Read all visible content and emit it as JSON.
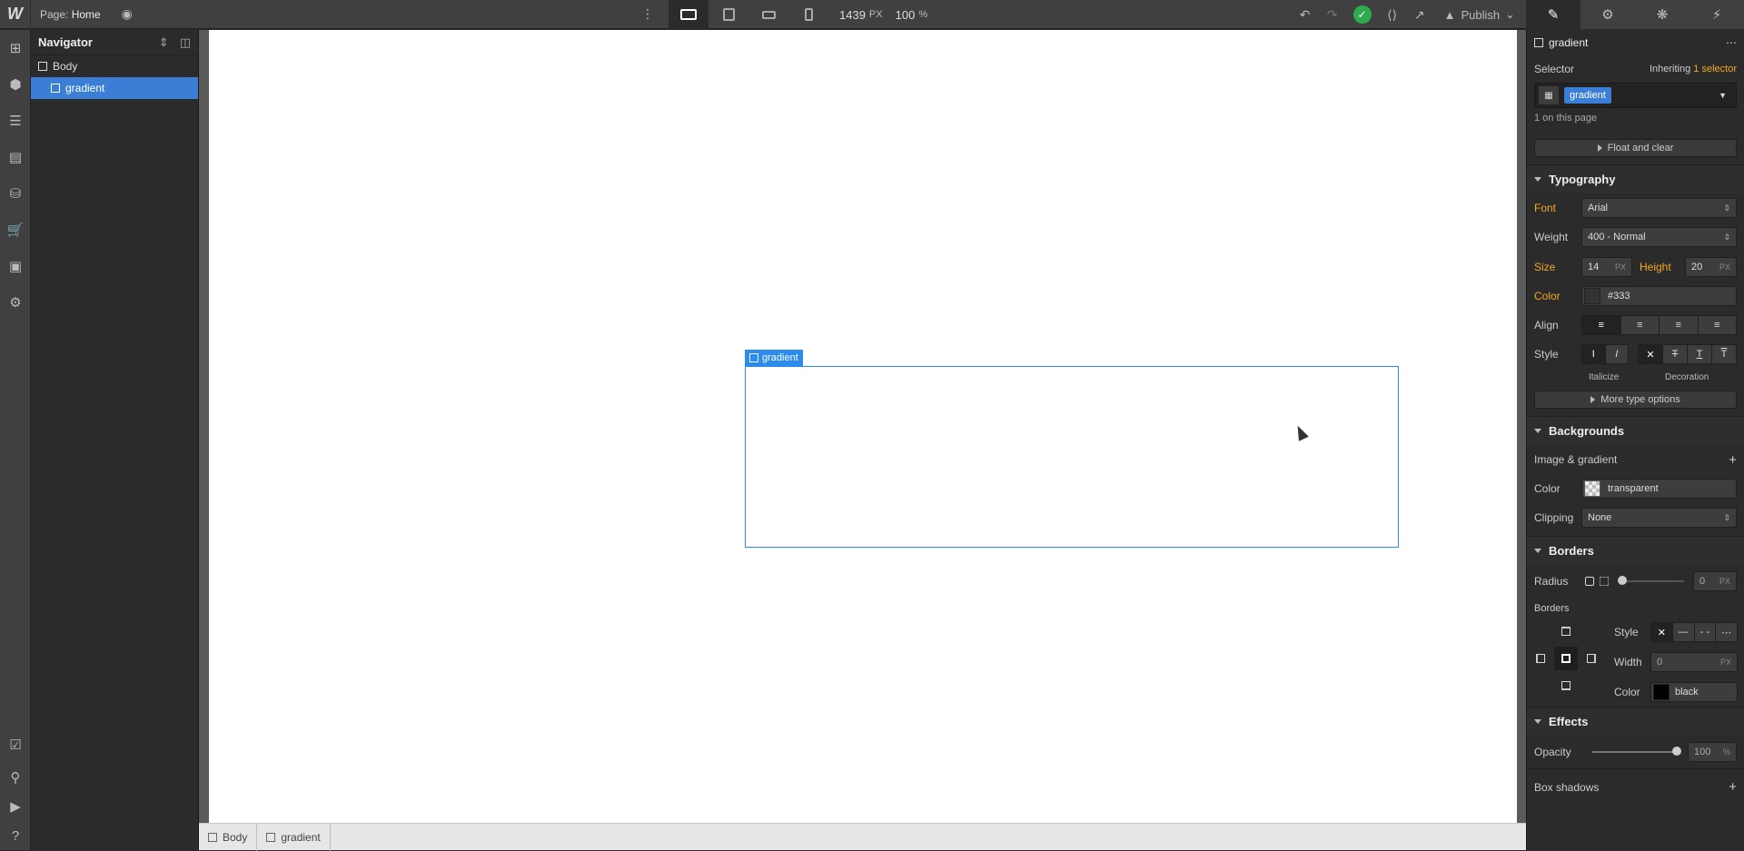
{
  "topbar": {
    "logo": "W",
    "page_prefix": "Page:",
    "page_name": "Home",
    "width_value": "1439",
    "width_unit": "PX",
    "zoom_value": "100",
    "zoom_unit": "%",
    "publish_label": "Publish"
  },
  "navigator": {
    "title": "Navigator",
    "items": [
      {
        "label": "Body"
      },
      {
        "label": "gradient"
      }
    ]
  },
  "canvas": {
    "selected_label": "gradient"
  },
  "breadcrumb": {
    "items": [
      "Body",
      "gradient"
    ]
  },
  "style_panel": {
    "element_name": "gradient",
    "selector_label": "Selector",
    "inheriting_prefix": "Inheriting",
    "inheriting_link": "1 selector",
    "selector_tag": "gradient",
    "on_page": "1 on this page",
    "float_clear": "Float and clear",
    "typography": {
      "title": "Typography",
      "font_label": "Font",
      "font_value": "Arial",
      "weight_label": "Weight",
      "weight_value": "400 - Normal",
      "size_label": "Size",
      "size_value": "14",
      "size_unit": "PX",
      "height_label": "Height",
      "height_value": "20",
      "height_unit": "PX",
      "color_label": "Color",
      "color_value": "#333",
      "align_label": "Align",
      "style_label": "Style",
      "italicize_caption": "Italicize",
      "decoration_caption": "Decoration",
      "more_options": "More type options"
    },
    "backgrounds": {
      "title": "Backgrounds",
      "image_gradient": "Image & gradient",
      "color_label": "Color",
      "color_value": "transparent",
      "clipping_label": "Clipping",
      "clipping_value": "None"
    },
    "borders": {
      "title": "Borders",
      "radius_label": "Radius",
      "radius_value": "0",
      "radius_unit": "PX",
      "borders_label": "Borders",
      "style_label": "Style",
      "width_label": "Width",
      "width_value": "0",
      "width_unit": "PX",
      "color_label": "Color",
      "color_value": "black"
    },
    "effects": {
      "title": "Effects",
      "opacity_label": "Opacity",
      "opacity_value": "100",
      "opacity_unit": "%",
      "box_shadows": "Box shadows"
    }
  },
  "colors": {
    "accent": "#3a7fd5",
    "selection": "#2d8ceb",
    "highlight": "#f5a623",
    "success": "#2eaa4f"
  }
}
